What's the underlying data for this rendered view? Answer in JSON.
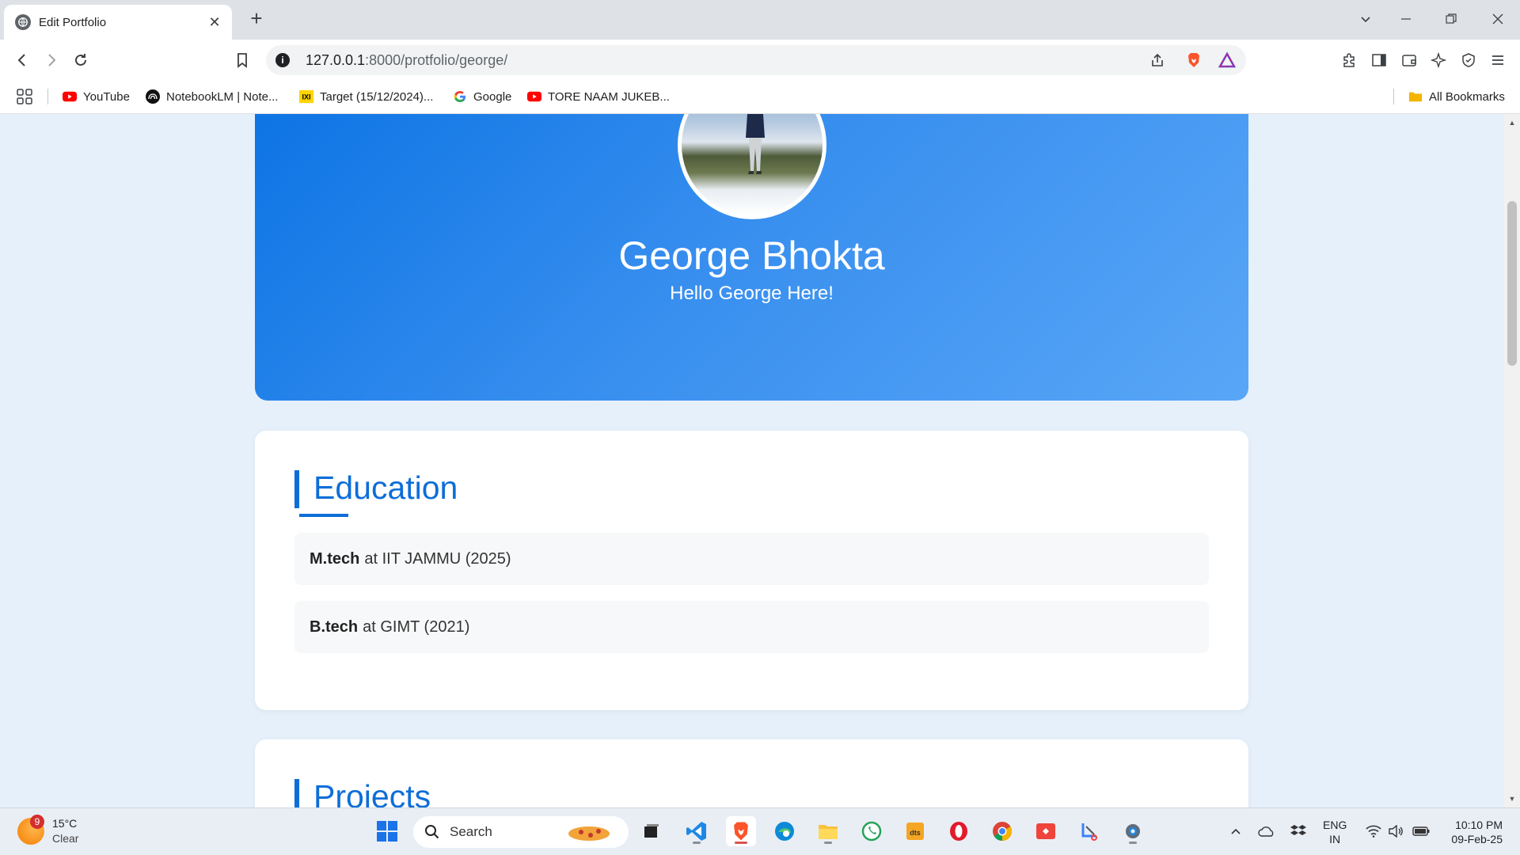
{
  "browser": {
    "tab_title": "Edit Portfolio",
    "url_host": "127.0.0.1",
    "url_path": ":8000/protfolio/george/",
    "bookmarks": [
      {
        "label": "YouTube",
        "icon": "youtube-icon"
      },
      {
        "label": "NotebookLM | Note...",
        "icon": "notebooklm-icon"
      },
      {
        "label": "Target (15/12/2024)...",
        "icon": "ixl-icon"
      },
      {
        "label": "Google",
        "icon": "google-icon"
      },
      {
        "label": "TORE NAAM JUKEB...",
        "icon": "youtube-icon"
      }
    ],
    "all_bookmarks": "All Bookmarks"
  },
  "profile": {
    "name": "George Bhokta",
    "bio": "Hello George Here!"
  },
  "education": {
    "title": "Education",
    "items": [
      {
        "degree": "M.tech",
        "rest": "at IIT JAMMU (2025)"
      },
      {
        "degree": "B.tech",
        "rest": "at GIMT (2021)"
      }
    ]
  },
  "projects": {
    "title": "Projects"
  },
  "taskbar": {
    "weather_temp": "15°C",
    "weather_cond": "Clear",
    "weather_badge": "9",
    "search_placeholder": "Search",
    "lang_1": "ENG",
    "lang_2": "IN",
    "time": "10:10 PM",
    "date": "09-Feb-25"
  },
  "colors": {
    "accent": "#0d6ed8",
    "hero_start": "#0d74e4",
    "hero_end": "#58a6f7",
    "page_bg": "#e6f0fb"
  }
}
